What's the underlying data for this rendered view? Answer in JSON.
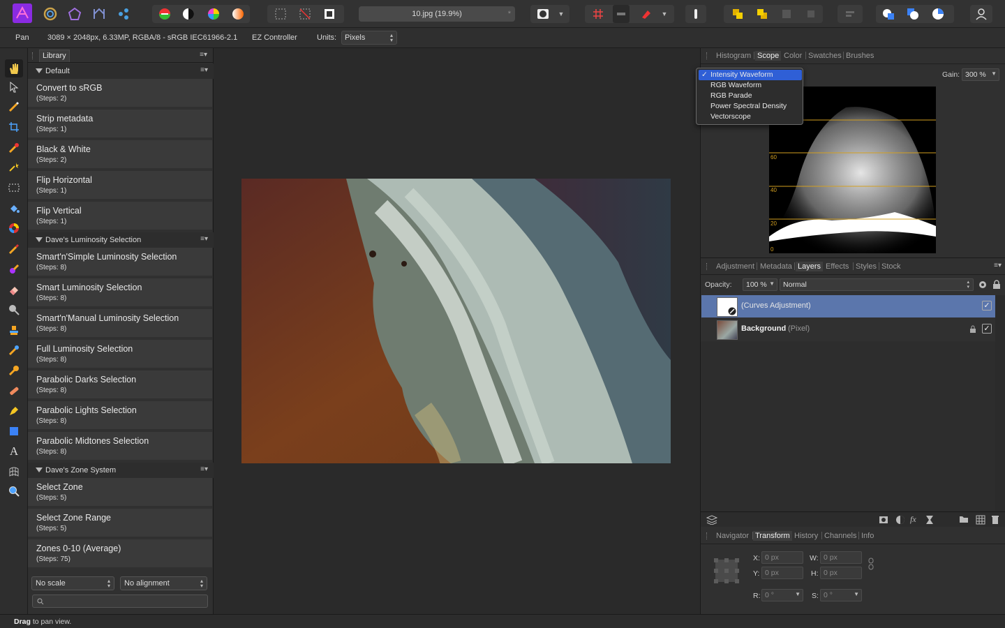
{
  "toolbar": {
    "document_title": "10.jpg (19.9%)",
    "modified_marker": "*"
  },
  "context_bar": {
    "tool_name": "Pan",
    "image_info": "3089 × 2048px, 6.33MP, RGBA/8 - sRGB IEC61966-2.1",
    "ez_controller": "EZ Controller",
    "units_label": "Units:",
    "units_value": "Pixels"
  },
  "library": {
    "tab": "Library",
    "categories": [
      {
        "name": "Default",
        "macros": [
          {
            "title": "Convert to sRGB",
            "steps": "(Steps: 2)"
          },
          {
            "title": "Strip metadata",
            "steps": "(Steps: 1)"
          },
          {
            "title": "Black & White",
            "steps": "(Steps: 2)"
          },
          {
            "title": "Flip Horizontal",
            "steps": "(Steps: 1)"
          },
          {
            "title": "Flip Vertical",
            "steps": "(Steps: 1)"
          }
        ]
      },
      {
        "name": "Dave's Luminosity Selection",
        "macros": [
          {
            "title": "Smart'n'Simple Luminosity Selection",
            "steps": "(Steps: 8)"
          },
          {
            "title": "Smart Luminosity Selection",
            "steps": "(Steps: 8)"
          },
          {
            "title": "Smart'n'Manual Luminosity Selection",
            "steps": "(Steps: 8)"
          },
          {
            "title": "Full Luminosity Selection",
            "steps": "(Steps: 8)"
          },
          {
            "title": "Parabolic Darks Selection",
            "steps": "(Steps: 8)"
          },
          {
            "title": "Parabolic Lights Selection",
            "steps": "(Steps: 8)"
          },
          {
            "title": "Parabolic Midtones Selection",
            "steps": "(Steps: 8)"
          }
        ]
      },
      {
        "name": "Dave's Zone System",
        "macros": [
          {
            "title": "Select Zone",
            "steps": "(Steps: 5)"
          },
          {
            "title": "Select Zone Range",
            "steps": "(Steps: 5)"
          },
          {
            "title": "Zones 0-10 (Average)",
            "steps": "(Steps: 75)"
          }
        ]
      }
    ],
    "scale_select": "No scale",
    "alignment_select": "No alignment"
  },
  "scope_panel": {
    "tabs": [
      "Histogram",
      "Scope",
      "Color",
      "Swatches",
      "Brushes"
    ],
    "active_tab": "Scope",
    "gain_label": "Gain:",
    "gain_value": "300 %",
    "scope_ticks": [
      "60",
      "40",
      "20",
      "0"
    ],
    "dropdown": {
      "selected": "Intensity Waveform",
      "check": "✓",
      "options": [
        "Intensity Waveform",
        "RGB Waveform",
        "RGB Parade",
        "Power Spectral Density",
        "Vectorscope"
      ]
    }
  },
  "layers_panel": {
    "tabs": [
      "Adjustment",
      "Metadata",
      "Layers",
      "Effects",
      "Styles",
      "Stock"
    ],
    "active_tab": "Layers",
    "opacity_label": "Opacity:",
    "opacity_value": "100 %",
    "blend_mode": "Normal",
    "layers": [
      {
        "name": "(Curves Adjustment)",
        "type": "",
        "selected": true,
        "visible": "✓"
      },
      {
        "name": "Background",
        "type": "(Pixel)",
        "selected": false,
        "visible": "✓"
      }
    ]
  },
  "transform_panel": {
    "tabs": [
      "Navigator",
      "Transform",
      "History",
      "Channels",
      "Info"
    ],
    "active_tab": "Transform",
    "x_label": "X:",
    "x_value": "0 px",
    "y_label": "Y:",
    "y_value": "0 px",
    "w_label": "W:",
    "w_value": "0 px",
    "h_label": "H:",
    "h_value": "0 px",
    "r_label": "R:",
    "r_value": "0 °",
    "s_label": "S:",
    "s_value": "0 °"
  },
  "status_bar": {
    "bold": "Drag",
    "text": " to pan view."
  },
  "colors": {
    "accent": "#2f5fd6",
    "selected_layer": "#5b76ac",
    "scope_guides": "#d4a020"
  }
}
